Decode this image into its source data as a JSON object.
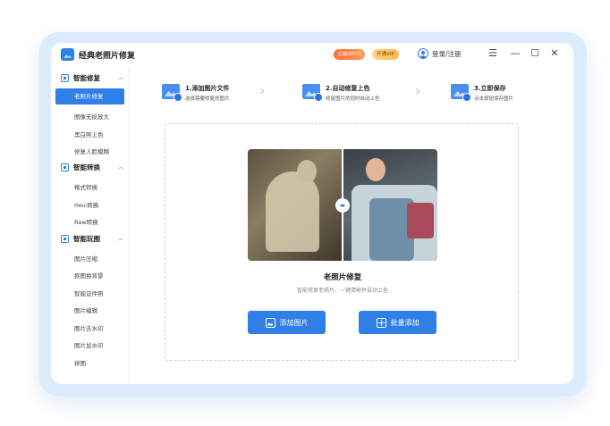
{
  "app": {
    "title": "经典老照片修复"
  },
  "header": {
    "promo_badge": "立减200元",
    "vip_badge": "开通VIP",
    "login_label": "登录/注册",
    "menu_icon": "☰",
    "minimize_icon": "—",
    "maximize_icon": "☐",
    "close_icon": "✕"
  },
  "sidebar": {
    "sections": [
      {
        "title": "智能修复",
        "items": [
          "老照片修复",
          "图像无损放大",
          "黑白照上色",
          "修复人脸模糊"
        ]
      },
      {
        "title": "智能转换",
        "items": [
          "格式转换",
          "Heic转换",
          "Raw转换"
        ]
      },
      {
        "title": "智能玩图",
        "items": [
          "图片压缩",
          "抠图换背景",
          "智能证件照",
          "图片编辑",
          "图片去水印",
          "图片加水印",
          "拼图"
        ]
      }
    ],
    "active_item": "老照片修复"
  },
  "steps": [
    {
      "title": "1.添加图片文件",
      "desc": "选择需要修复的图片"
    },
    {
      "title": "2.自动修复上色",
      "desc": "修复图片的同时自动上色"
    },
    {
      "title": "3.立即保存",
      "desc": "点击按钮保存图片"
    }
  ],
  "preview": {
    "title": "老照片修复",
    "subtitle": "智能修复老照片，一键清晰并自动上色",
    "compare_knob": "◂▸"
  },
  "buttons": {
    "add_image": "添加图片",
    "batch_add": "批量添加"
  },
  "colors": {
    "accent": "#2f7fe6",
    "frame": "#dcecfb",
    "promo": "#ff6a3d",
    "vip": "#ffb54d"
  }
}
